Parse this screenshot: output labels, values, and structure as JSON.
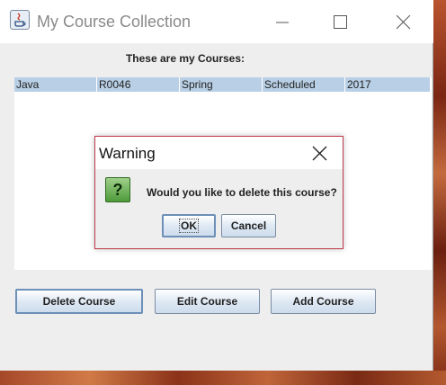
{
  "window": {
    "title": "My Course Collection",
    "heading": "These are my Courses:"
  },
  "table": {
    "rows": [
      {
        "name": "Java",
        "code": "R0046",
        "term": "Spring",
        "status": "Scheduled",
        "year": "2017"
      }
    ]
  },
  "buttons": {
    "delete": "Delete Course",
    "edit": "Edit Course",
    "add": "Add Course"
  },
  "dialog": {
    "title": "Warning",
    "icon": "question-icon",
    "icon_glyph": "?",
    "message": "Would you like to delete this course?",
    "ok": "OK",
    "cancel": "Cancel"
  },
  "colors": {
    "selection": "#b8cfe5",
    "dialog_border": "#c0394a",
    "question_icon": "#4e9a3a"
  }
}
